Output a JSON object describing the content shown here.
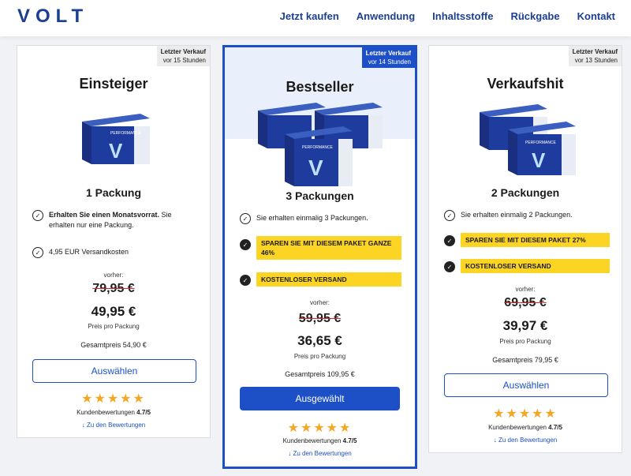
{
  "header": {
    "logo": "VOLT",
    "nav": [
      "Jetzt kaufen",
      "Anwendung",
      "Inhaltsstoffe",
      "Rückgabe",
      "Kontakt"
    ]
  },
  "plans": [
    {
      "badge_line1": "Letzter Verkauf",
      "badge_line2": "vor 15 Stunden",
      "title": "Einsteiger",
      "qty": "1 Packung",
      "features": [
        {
          "bold": "Erhalten Sie einen Monatsvorrat.",
          "text": " Sie erhalten nur eine Packung."
        },
        {
          "bold": "",
          "text": "4,95 EUR Versandkosten"
        }
      ],
      "vorher": "vorher:",
      "old_price": "79,95 €",
      "new_price": "49,95 €",
      "per_pack": "Preis pro Packung",
      "total": "Gesamtpreis 54,90 €",
      "button": "Auswählen",
      "stars": "★★★★★",
      "rating_label": "Kundenbewertungen",
      "rating_value": "4.7/5",
      "link": "↓ Zu den Bewertungen"
    },
    {
      "badge_line1": "Letzter Verkauf",
      "badge_line2": "vor 14 Stunden",
      "title": "Bestseller",
      "qty": "3 Packungen",
      "features": [
        {
          "text": "Sie erhalten einmalig 3 Packungen."
        },
        {
          "text": "SPAREN SIE MIT DIESEM PAKET GANZE 46%"
        },
        {
          "text": "KOSTENLOSER VERSAND"
        }
      ],
      "vorher": "vorher:",
      "old_price": "59,95 €",
      "new_price": "36,65 €",
      "per_pack": "Preis pro Packung",
      "total": "Gesamtpreis 109,95 €",
      "button": "Ausgewählt",
      "stars": "★★★★★",
      "rating_label": "Kundenbewertungen",
      "rating_value": "4.7/5",
      "link": "↓ Zu den Bewertungen"
    },
    {
      "badge_line1": "Letzter Verkauf",
      "badge_line2": "vor 13 Stunden",
      "title": "Verkaufshit",
      "qty": "2 Packungen",
      "features": [
        {
          "text": "Sie erhalten einmalig 2 Packungen."
        },
        {
          "text": "SPAREN SIE MIT DIESEM PAKET 27%"
        },
        {
          "text": "KOSTENLOSER VERSAND"
        }
      ],
      "vorher": "vorher:",
      "old_price": "69,95 €",
      "new_price": "39,97 €",
      "per_pack": "Preis pro Packung",
      "total": "Gesamtpreis 79,95 €",
      "button": "Auswählen",
      "stars": "★★★★★",
      "rating_label": "Kundenbewertungen",
      "rating_value": "4.7/5",
      "link": "↓ Zu den Bewertungen"
    }
  ],
  "product_box_label": "PERFORMANCE",
  "product_letter": "V",
  "colors": {
    "brand": "#1c3f93",
    "accent": "#1d50c6",
    "highlight": "#fcd423",
    "star": "#f5a623",
    "strike": "#d62828"
  },
  "icons": [
    "check-circle-icon",
    "star-icon",
    "arrow-down-icon"
  ]
}
